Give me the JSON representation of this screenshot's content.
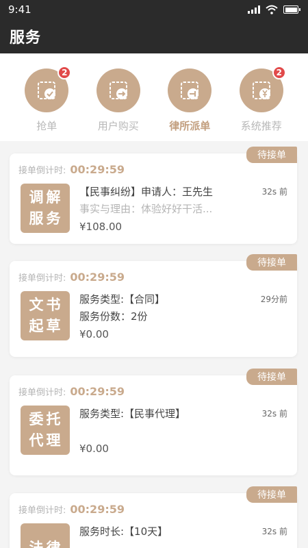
{
  "status_bar": {
    "time": "9:41"
  },
  "header": {
    "title": "服务"
  },
  "categories": [
    {
      "label": "抢单",
      "icon": "grab-order-icon",
      "badge": "2",
      "active": false
    },
    {
      "label": "用户购买",
      "icon": "user-purchase-icon",
      "badge": "",
      "active": false
    },
    {
      "label": "律所派单",
      "icon": "firm-dispatch-icon",
      "badge": "",
      "active": true
    },
    {
      "label": "系统推荐",
      "icon": "system-recommend-icon",
      "badge": "2",
      "active": false
    }
  ],
  "orders": [
    {
      "status": "待接单",
      "countdown_label": "接单倒计时:",
      "countdown": "00:29:59",
      "service_line1": "调解",
      "service_line2": "服务",
      "line1": "【民事纠纷】申请人：王先生",
      "line2": "事实与理由：体验好好干活...",
      "price": "¥108.00",
      "time_ago": "32s 前"
    },
    {
      "status": "待接单",
      "countdown_label": "接单倒计时:",
      "countdown": "00:29:59",
      "service_line1": "文书",
      "service_line2": "起草",
      "line1": "服务类型:【合同】",
      "line2": "服务份数：2份",
      "price": "¥0.00",
      "time_ago": "29分前"
    },
    {
      "status": "待接单",
      "countdown_label": "接单倒计时:",
      "countdown": "00:29:59",
      "service_line1": "委托",
      "service_line2": "代理",
      "line1": "服务类型:【民事代理】",
      "line2": "",
      "price": "¥0.00",
      "time_ago": "32s 前"
    },
    {
      "status": "待接单",
      "countdown_label": "接单倒计时:",
      "countdown": "00:29:59",
      "service_line1": "法律",
      "service_line2": "",
      "line1": "服务时长:【10天】",
      "line2": "",
      "price": "",
      "time_ago": "32s 前"
    }
  ],
  "colors": {
    "accent": "#c9aa8d",
    "header_bg": "#2b2b2b",
    "badge": "#e14a4a"
  }
}
